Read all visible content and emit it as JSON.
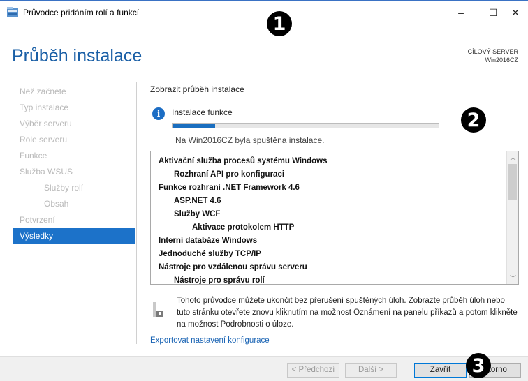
{
  "window": {
    "title": "Průvodce přidáním rolí a funkcí",
    "minimize_glyph": "–",
    "maximize_glyph": "☐",
    "close_glyph": "✕"
  },
  "header": {
    "page_title": "Průběh instalace",
    "target_label": "CÍLOVÝ SERVER",
    "target_server": "Win2016CZ"
  },
  "markers": [
    "1",
    "2",
    "3"
  ],
  "nav": {
    "items": [
      {
        "label": "Než začnete",
        "level": 0,
        "active": false
      },
      {
        "label": "Typ instalace",
        "level": 0,
        "active": false
      },
      {
        "label": "Výběr serveru",
        "level": 0,
        "active": false
      },
      {
        "label": "Role serveru",
        "level": 0,
        "active": false
      },
      {
        "label": "Funkce",
        "level": 0,
        "active": false
      },
      {
        "label": "Služba WSUS",
        "level": 0,
        "active": false
      },
      {
        "label": "Služby rolí",
        "level": 1,
        "active": false
      },
      {
        "label": "Obsah",
        "level": 2,
        "active": false
      },
      {
        "label": "Potvrzení",
        "level": 0,
        "active": false
      },
      {
        "label": "Výsledky",
        "level": 0,
        "active": true
      }
    ]
  },
  "content": {
    "section_label": "Zobrazit průběh instalace",
    "info_icon_glyph": "i",
    "status_title": "Instalace funkce",
    "progress": 0.16,
    "status_text": "Na Win2016CZ byla spuštěna instalace.",
    "features": [
      {
        "label": "Aktivační služba procesů systému Windows",
        "level": 0
      },
      {
        "label": "Rozhraní API pro konfiguraci",
        "level": 1
      },
      {
        "label": "Funkce rozhraní .NET Framework 4.6",
        "level": 0
      },
      {
        "label": "ASP.NET 4.6",
        "level": 1
      },
      {
        "label": "Služby WCF",
        "level": 1
      },
      {
        "label": "Aktivace protokolem HTTP",
        "level": 2
      },
      {
        "label": "Interní databáze Windows",
        "level": 0
      },
      {
        "label": "Jednoduché služby TCP/IP",
        "level": 0
      },
      {
        "label": "Nástroje pro vzdálenou správu serveru",
        "level": 0
      },
      {
        "label": "Nástroje pro správu rolí",
        "level": 1
      }
    ],
    "scroll_up_glyph": "︿",
    "scroll_down_glyph": "﹀",
    "note_text": "Tohoto průvodce můžete ukončit bez přerušení spuštěných úloh. Zobrazte průběh úloh nebo tuto stránku otevřete znovu kliknutím na možnost Oznámení na panelu příkazů a potom klikněte na možnost Podrobnosti o úloze.",
    "export_link": "Exportovat nastavení konfigurace"
  },
  "footer": {
    "prev_label": "< Předchozí",
    "next_label": "Další >",
    "close_label": "Zavřít",
    "cancel_label": "Storno"
  },
  "colors": {
    "accent": "#1c72c9",
    "title_blue": "#1a5fa6",
    "progress_fill": "#1a6ebf"
  }
}
